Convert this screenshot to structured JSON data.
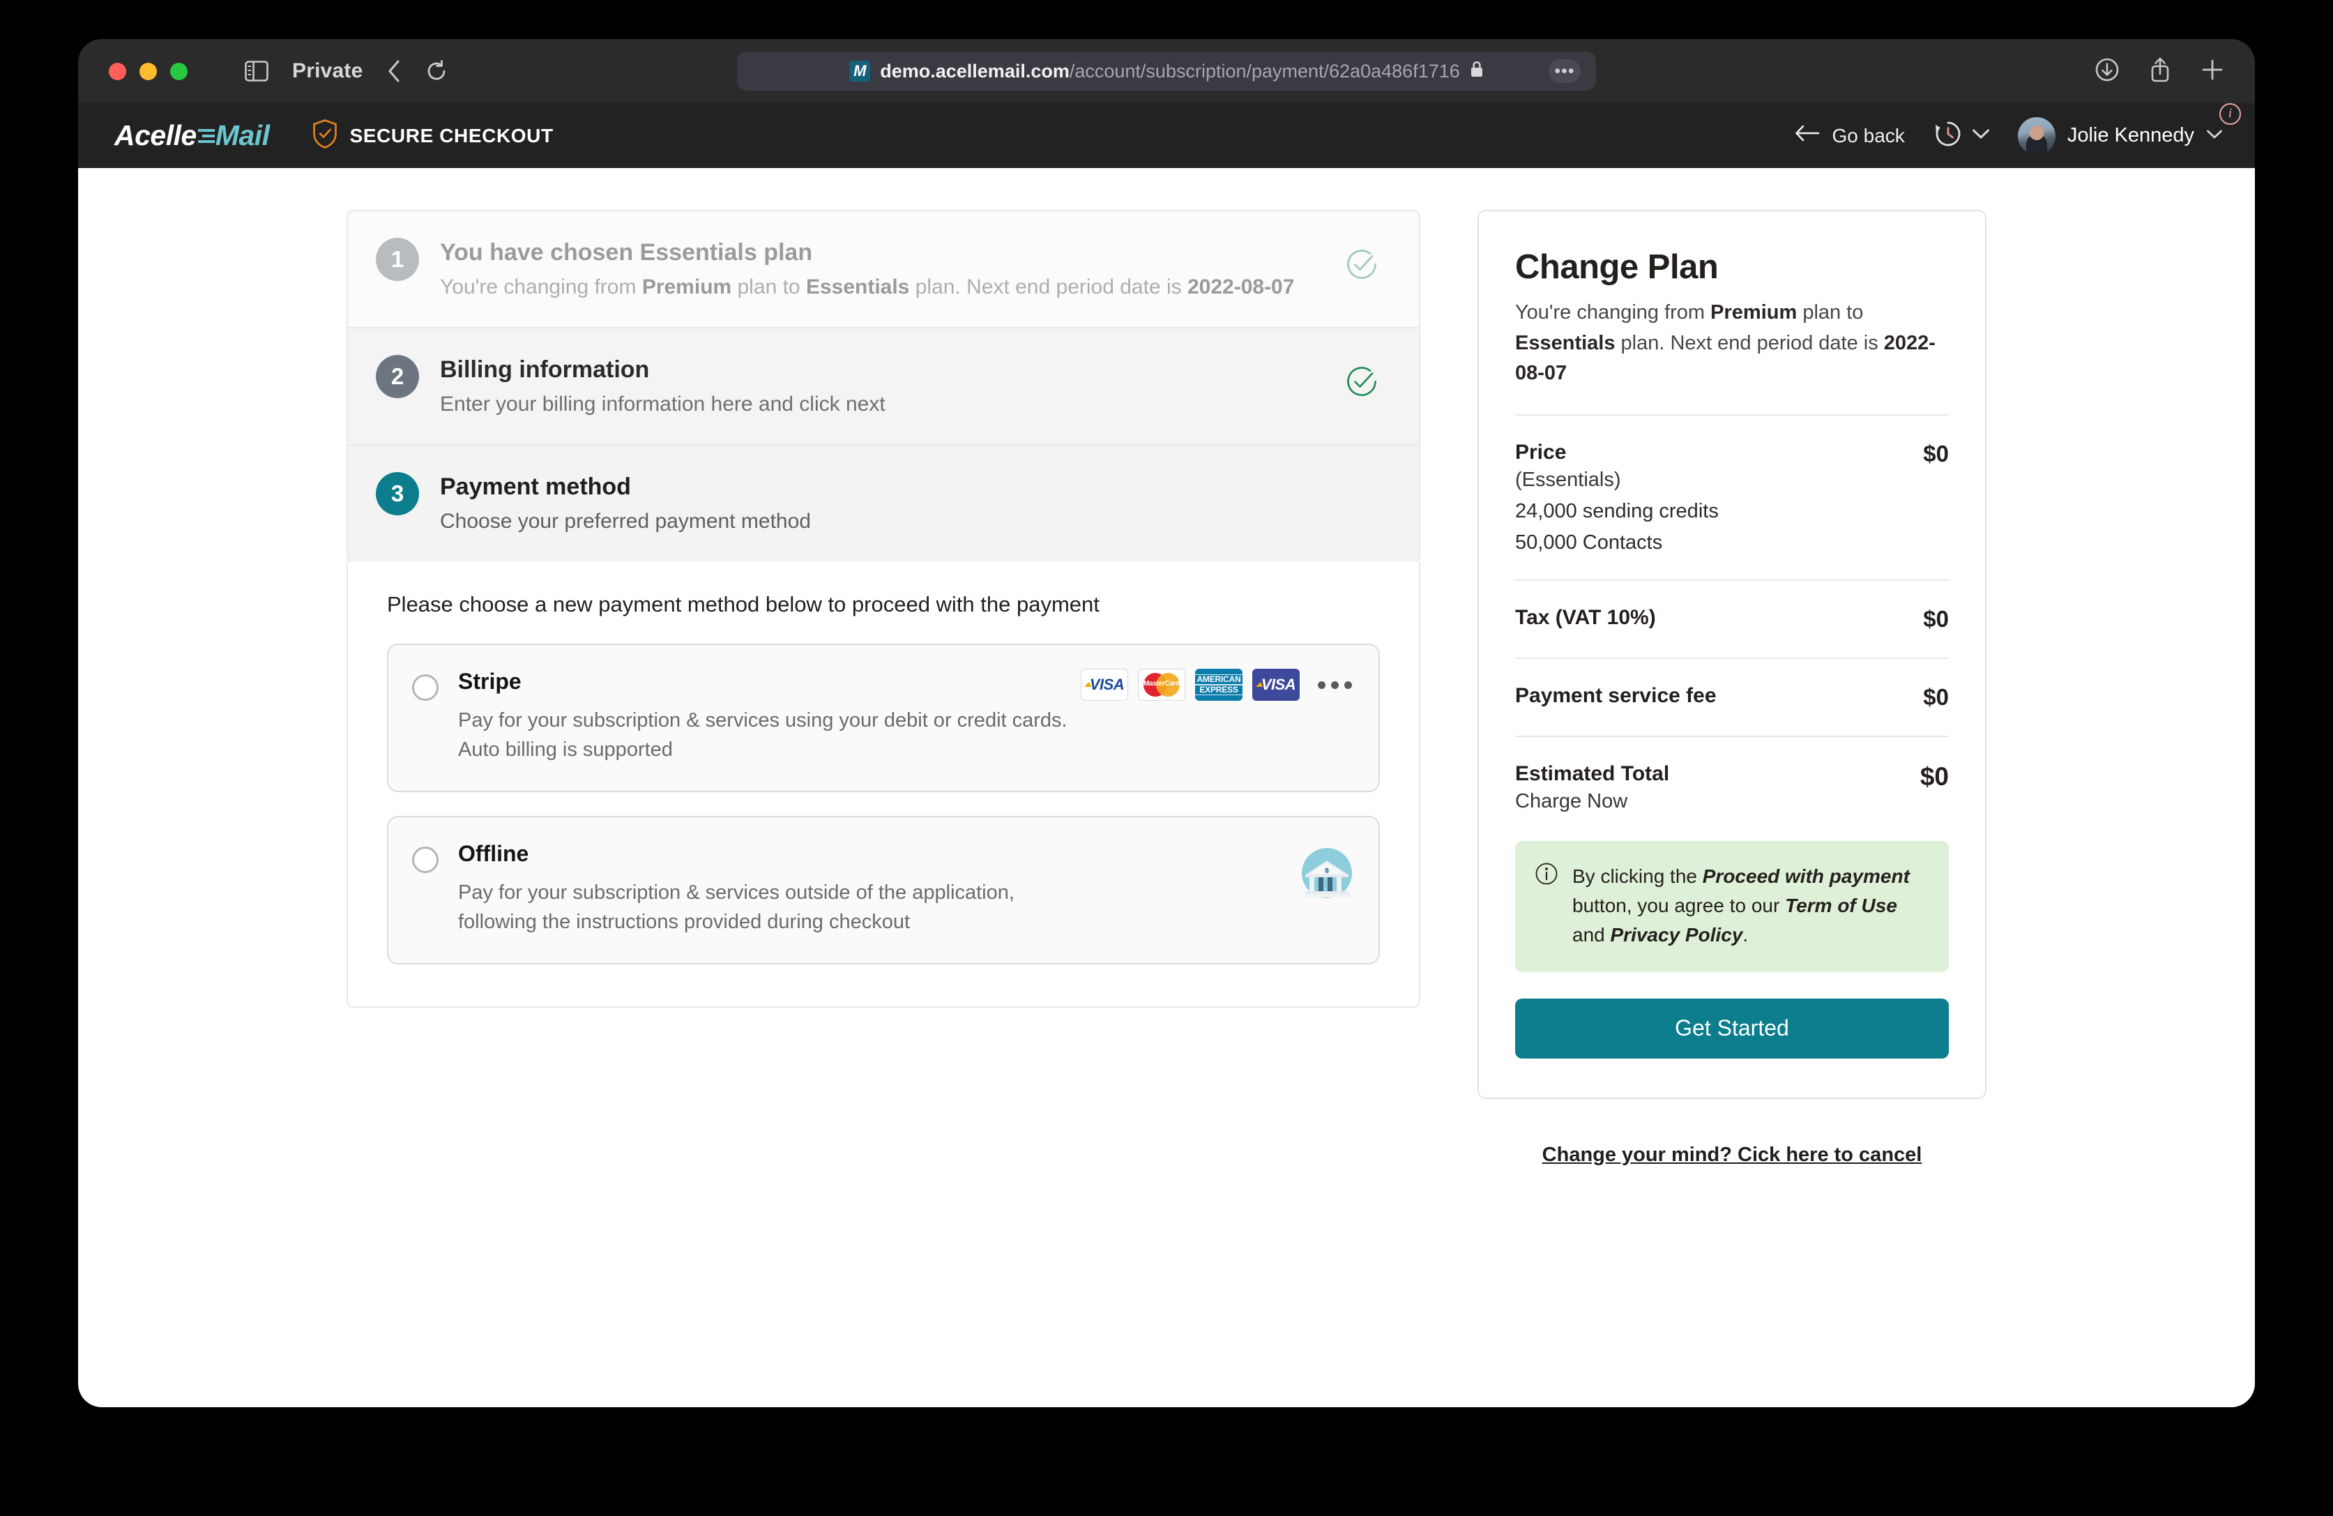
{
  "browser": {
    "private_label": "Private",
    "url_host": "demo.acellemail.com",
    "url_path": "/account/subscription/payment/62a0a486f1716",
    "favicon_letter": "M",
    "more_glyph": "•••"
  },
  "appbar": {
    "logo_primary": "Acelle",
    "logo_secondary": "Mail",
    "secure_label": "SECURE CHECKOUT",
    "go_back_label": "Go back",
    "user_name": "Jolie Kennedy",
    "info_glyph": "i"
  },
  "steps": [
    {
      "number": "1",
      "title": "You have chosen Essentials plan",
      "sub_prefix": "You're changing from ",
      "sub_from": "Premium",
      "sub_mid": " plan to ",
      "sub_to": "Essentials",
      "sub_tail": " plan. Next end period date is ",
      "sub_date": "2022-08-07",
      "state": "completed-muted"
    },
    {
      "number": "2",
      "title": "Billing information",
      "sub": "Enter your billing information here and click next",
      "state": "completed"
    },
    {
      "number": "3",
      "title": "Payment method",
      "sub": "Choose your preferred payment method",
      "state": "active"
    }
  ],
  "payment": {
    "lead": "Please choose a new payment method below to proceed with the payment",
    "methods": [
      {
        "name": "Stripe",
        "description": "Pay for your subscription & services using your debit or credit cards. Auto billing is supported",
        "selected": false,
        "card_brands": [
          "visa",
          "mastercard",
          "amex",
          "visa-blue"
        ],
        "visa_label": "VISA",
        "mastercard_label": "MasterCard",
        "amex_label_1": "AMERICAN",
        "amex_label_2": "EXPRESS"
      },
      {
        "name": "Offline",
        "description": "Pay for your subscription & services outside of the application, following the instructions provided during checkout",
        "selected": false,
        "icon": "bank-icon"
      }
    ]
  },
  "summary": {
    "title": "Change Plan",
    "sub_prefix": "You're changing from ",
    "sub_from": "Premium",
    "sub_mid": " plan to ",
    "sub_to": "Essentials",
    "sub_tail": " plan. Next end period date is ",
    "sub_date": "2022-08-07",
    "price_label": "Price",
    "price_plan": "(Essentials)",
    "price_amount": "$0",
    "features": [
      "24,000 sending credits",
      "50,000 Contacts"
    ],
    "tax_label": "Tax (VAT 10%)",
    "tax_amount": "$0",
    "fee_label": "Payment service fee",
    "fee_amount": "$0",
    "total_label": "Estimated Total",
    "total_sub": "Charge Now",
    "total_amount": "$0",
    "notice_pre": "By clicking the ",
    "notice_em1": "Proceed with payment",
    "notice_mid": " button, you agree to our ",
    "notice_em2": "Term of Use",
    "notice_and": " and ",
    "notice_em3": "Privacy Policy",
    "notice_end": ".",
    "cta_label": "Get Started",
    "cancel_label": "Change your mind? Cick here to cancel"
  },
  "colors": {
    "accent_teal": "#0b7d8c",
    "logo_teal": "#6cc5cf",
    "shield_orange": "#e8851f",
    "check_green": "#1f8a53",
    "notice_green_bg": "#dff0d8"
  }
}
